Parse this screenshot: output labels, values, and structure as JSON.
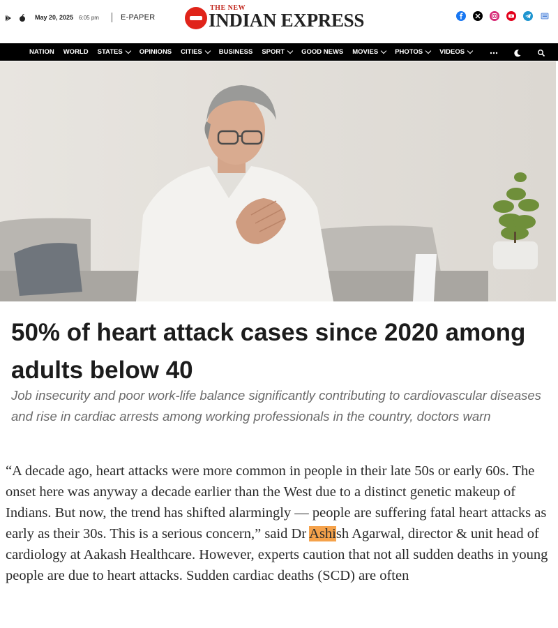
{
  "topbar": {
    "date": "May 20, 2025",
    "time": "6:05 pm",
    "epaper_label": "E-PAPER",
    "logo_top": "THE NEW",
    "logo_main": "INDIAN EXPRESS",
    "social_icons": [
      "facebook-icon",
      "x-icon",
      "instagram-icon",
      "youtube-icon",
      "telegram-icon",
      "news-icon"
    ],
    "logo_color": "#e0241a"
  },
  "nav": {
    "items": [
      {
        "label": "NATION",
        "dropdown": false
      },
      {
        "label": "WORLD",
        "dropdown": false
      },
      {
        "label": "STATES",
        "dropdown": true
      },
      {
        "label": "OPINIONS",
        "dropdown": false
      },
      {
        "label": "CITIES",
        "dropdown": true
      },
      {
        "label": "BUSINESS",
        "dropdown": false
      },
      {
        "label": "SPORT",
        "dropdown": true
      },
      {
        "label": "GOOD NEWS",
        "dropdown": false
      },
      {
        "label": "MOVIES",
        "dropdown": true
      },
      {
        "label": "PHOTOS",
        "dropdown": true
      },
      {
        "label": "VIDEOS",
        "dropdown": true
      }
    ],
    "right_icons": [
      "more-icon",
      "dark-mode-icon",
      "search-icon"
    ]
  },
  "article": {
    "headline": "50% of heart attack cases since 2020 among adults below 40",
    "standfirst": "Job insecurity and poor work-life balance significantly contributing to cardiovascular diseases and rise in cardiac arrests among working professionals in the country, doctors warn",
    "body_before": "“A decade ago, heart attacks were more common in people in their late 50s or early 60s. The onset here was anyway a decade earlier than the West due to a distinct genetic makeup of Indians. But now, the trend has shifted alarmingly — people are suffering fatal heart attacks as early as their 30s. This is a serious concern,” said Dr ",
    "body_highlight": "Ashi",
    "body_after": "sh Agarwal, director & unit head of cardiology at Aakash Healthcare. However, experts caution that not all sudden deaths in young people are due to heart attacks. Sudden cardiac deaths (SCD) are often"
  },
  "colors": {
    "nav_bg": "#000000",
    "highlight": "#f5a24b",
    "standfirst_text": "#6a6a6a"
  }
}
